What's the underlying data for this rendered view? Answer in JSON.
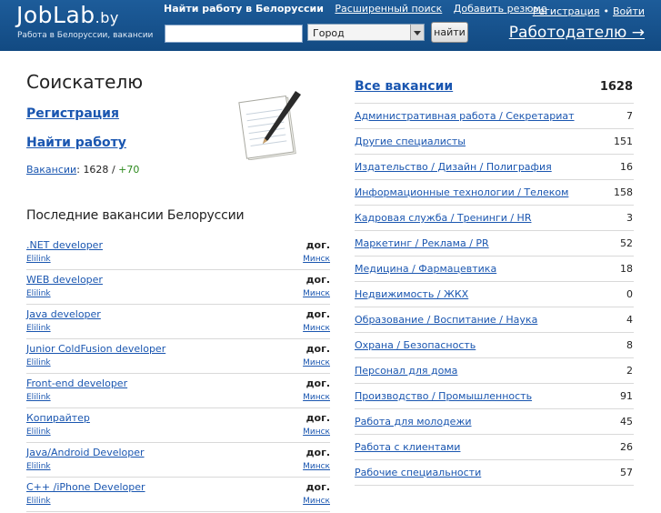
{
  "header": {
    "logo_main": "JobLab",
    "logo_tld": ".by",
    "tagline": "Работа в Белоруссии, вакансии",
    "nav": [
      {
        "label": "Найти работу в Белоруссии",
        "active": true
      },
      {
        "label": "Расширенный поиск",
        "active": false
      },
      {
        "label": "Добавить резюме",
        "active": false
      }
    ],
    "auth": {
      "register": "Регистрация",
      "separator": "•",
      "login": "Войти"
    },
    "search_value": "",
    "city_select": "Город",
    "find_button": "найти",
    "employer_link": "Работодателю →"
  },
  "left": {
    "title": "Соискателю",
    "register_link": "Регистрация",
    "find_link": "Найти работу",
    "vacancies_label": "Вакансии",
    "vacancies_colon": ":",
    "vacancies_total": "1628",
    "vacancies_slash": "/",
    "vacancies_new": "+70",
    "latest_title": "Последние вакансии Белоруссии",
    "jobs": [
      {
        "title": ".NET developer",
        "salary": "дог.",
        "company": "Elilink",
        "city": "Минск"
      },
      {
        "title": "WEB developer",
        "salary": "дог.",
        "company": "Elilink",
        "city": "Минск"
      },
      {
        "title": "Java developer",
        "salary": "дог.",
        "company": "Elilink",
        "city": "Минск"
      },
      {
        "title": "Junior ColdFusion developer",
        "salary": "дог.",
        "company": "Elilink",
        "city": "Минск"
      },
      {
        "title": "Front-end developer",
        "salary": "дог.",
        "company": "Elilink",
        "city": "Минск"
      },
      {
        "title": "Копирайтер",
        "salary": "дог.",
        "company": "Elilink",
        "city": "Минск"
      },
      {
        "title": "Java/Android Developer",
        "salary": "дог.",
        "company": "Elilink",
        "city": "Минск"
      },
      {
        "title": "C++ /iPhone Developer",
        "salary": "дог.",
        "company": "Elilink",
        "city": "Минск"
      }
    ]
  },
  "right": {
    "all_link": "Все вакансии",
    "all_count": "1628",
    "categories": [
      {
        "name": "Административная работа / Секретариат",
        "count": "7"
      },
      {
        "name": "Другие специалисты",
        "count": "151"
      },
      {
        "name": "Издательство / Дизайн / Полиграфия",
        "count": "16"
      },
      {
        "name": "Информационные технологии / Телеком",
        "count": "158"
      },
      {
        "name": "Кадровая служба / Тренинги / HR",
        "count": "3"
      },
      {
        "name": "Маркетинг / Реклама / PR",
        "count": "52"
      },
      {
        "name": "Медицина / Фармацевтика",
        "count": "18"
      },
      {
        "name": "Недвижимость / ЖКХ",
        "count": "0"
      },
      {
        "name": "Образование / Воспитание / Наука",
        "count": "4"
      },
      {
        "name": "Охрана / Безопасность",
        "count": "8"
      },
      {
        "name": "Персонал для дома",
        "count": "2"
      },
      {
        "name": "Производство / Промышленность",
        "count": "91"
      },
      {
        "name": "Работа для молодежи",
        "count": "45"
      },
      {
        "name": "Работа с клиентами",
        "count": "26"
      },
      {
        "name": "Рабочие специальности",
        "count": "57"
      }
    ]
  },
  "colors": {
    "header_bg": "#1a5591",
    "link": "#1a56b0",
    "new_count": "#2d8a1e"
  },
  "icons": {
    "notepad": "notepad-pen-icon",
    "select_arrow": "chevron-down-icon"
  }
}
